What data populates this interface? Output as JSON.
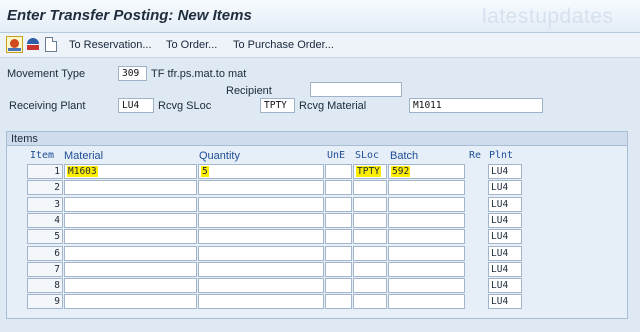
{
  "window": {
    "title": "Enter Transfer Posting: New Items",
    "watermark": "latestupdates"
  },
  "toolbar": {
    "buttons": [
      {
        "label": "To Reservation..."
      },
      {
        "label": "To Order..."
      },
      {
        "label": "To Purchase Order..."
      }
    ]
  },
  "header": {
    "movement_type_label": "Movement Type",
    "movement_type_value": "309",
    "movement_type_desc": "TF tfr.ps.mat.to mat",
    "recipient_label": "Recipient",
    "recipient_value": "",
    "receiving_plant_label": "Receiving Plant",
    "receiving_plant_value": "LU4",
    "rcvg_sloc_label": "Rcvg SLoc",
    "rcvg_sloc_value": "TPTY",
    "rcvg_material_label": "Rcvg Material",
    "rcvg_material_value": "M1011"
  },
  "items": {
    "group_title": "Items",
    "columns": {
      "item": "Item",
      "material": "Material",
      "quantity": "Quantity",
      "une": "UnE",
      "sloc": "SLoc",
      "batch": "Batch",
      "re": "Re",
      "plnt": "Plnt"
    },
    "rows": [
      {
        "item": "1",
        "material": "M1603",
        "quantity": "5",
        "une": "",
        "sloc": "TPTY",
        "batch": "592",
        "plnt": "LU4"
      },
      {
        "item": "2",
        "material": "",
        "quantity": "",
        "une": "",
        "sloc": "",
        "batch": "",
        "plnt": "LU4"
      },
      {
        "item": "3",
        "material": "",
        "quantity": "",
        "une": "",
        "sloc": "",
        "batch": "",
        "plnt": "LU4"
      },
      {
        "item": "4",
        "material": "",
        "quantity": "",
        "une": "",
        "sloc": "",
        "batch": "",
        "plnt": "LU4"
      },
      {
        "item": "5",
        "material": "",
        "quantity": "",
        "une": "",
        "sloc": "",
        "batch": "",
        "plnt": "LU4"
      },
      {
        "item": "6",
        "material": "",
        "quantity": "",
        "une": "",
        "sloc": "",
        "batch": "",
        "plnt": "LU4"
      },
      {
        "item": "7",
        "material": "",
        "quantity": "",
        "une": "",
        "sloc": "",
        "batch": "",
        "plnt": "LU4"
      },
      {
        "item": "8",
        "material": "",
        "quantity": "",
        "une": "",
        "sloc": "",
        "batch": "",
        "plnt": "LU4"
      },
      {
        "item": "9",
        "material": "",
        "quantity": "",
        "une": "",
        "sloc": "",
        "batch": "",
        "plnt": "LU4"
      }
    ]
  },
  "colors": {
    "highlight": "#ffee00",
    "column_header": "#1e4e96"
  }
}
